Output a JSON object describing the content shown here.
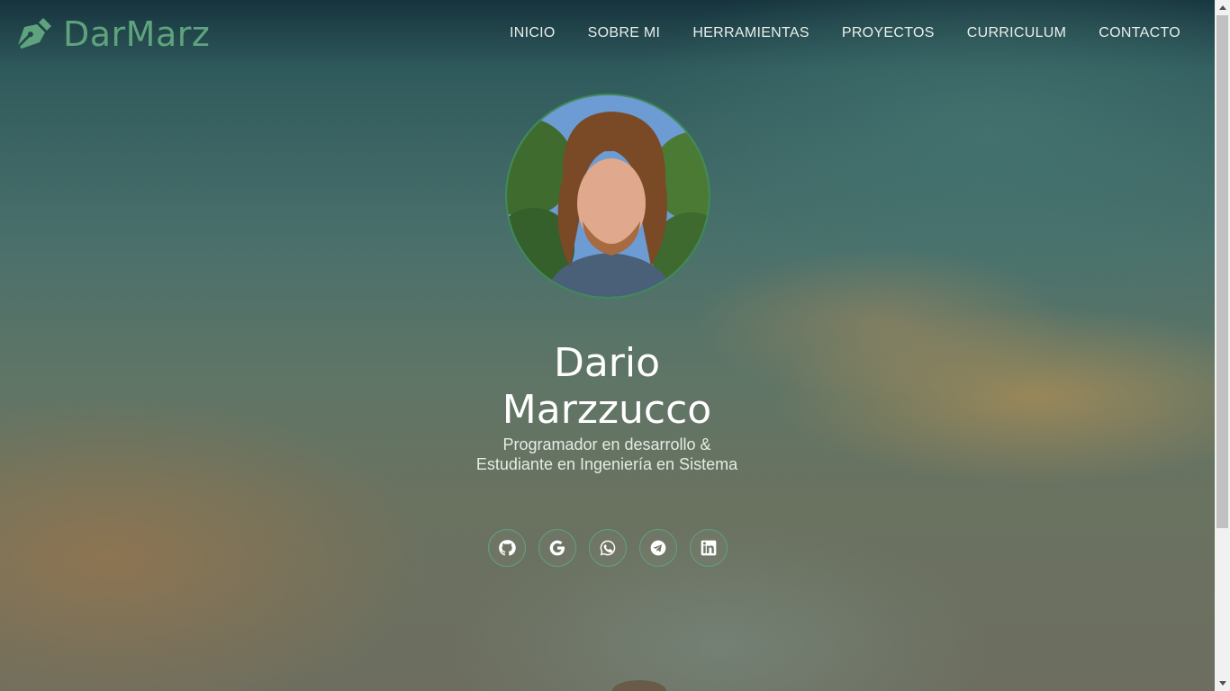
{
  "brand": {
    "name": "DarMarz",
    "icon": "pen-nib-icon",
    "color": "#5fa37e"
  },
  "nav": {
    "items": [
      {
        "label": "INICIO"
      },
      {
        "label": "SOBRE MI"
      },
      {
        "label": "HERRAMIENTAS"
      },
      {
        "label": "PROYECTOS"
      },
      {
        "label": "CURRICULUM"
      },
      {
        "label": "CONTACTO"
      }
    ]
  },
  "hero": {
    "avatar": "profile-photo",
    "name_line1": "Dario",
    "name_line2": "Marzzucco",
    "subtitle": "Programador en desarrollo & Estudiante en Ingeniería en Sistema"
  },
  "socials": [
    {
      "icon": "github-icon"
    },
    {
      "icon": "google-icon"
    },
    {
      "icon": "whatsapp-icon"
    },
    {
      "icon": "telegram-icon"
    },
    {
      "icon": "linkedin-icon"
    }
  ],
  "colors": {
    "accent": "#5fa37e",
    "text": "#ffffff"
  }
}
